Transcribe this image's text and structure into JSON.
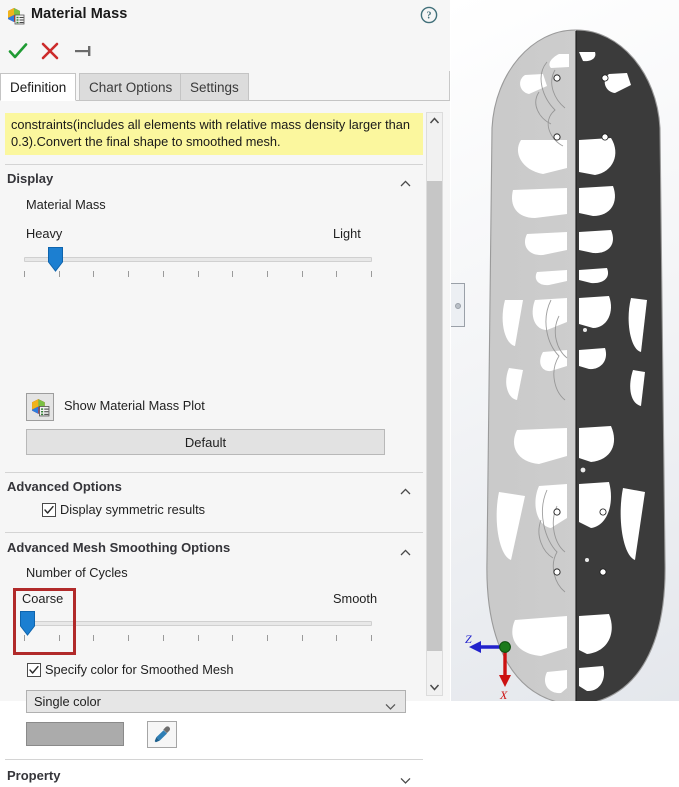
{
  "window": {
    "title": "Material Mass",
    "icon": "material-mass-icon",
    "help_icon": "help-icon"
  },
  "actions": [
    {
      "name": "accept-button",
      "icon": "checkmark-icon",
      "color": "#1f9b33"
    },
    {
      "name": "cancel-button",
      "icon": "x-mark-icon",
      "color": "#cc2b2b"
    },
    {
      "name": "pin-button",
      "icon": "pushpin-icon",
      "color": "#6b6b6b"
    }
  ],
  "tabs": [
    {
      "label": "Definition",
      "active": true
    },
    {
      "label": "Chart Options",
      "active": false
    },
    {
      "label": "Settings",
      "active": false
    }
  ],
  "message": "constraints(includes all elements with relative mass density larger than 0.3).Convert the final shape to smoothed mesh.",
  "sections": {
    "display": {
      "header": "Display",
      "collapsed": false,
      "subtitle": "Material Mass",
      "slider": {
        "left_label": "Heavy",
        "right_label": "Light",
        "value_percent": 9,
        "tick_count": 11
      },
      "plot_button_label": "Show Material Mass Plot",
      "plot_button_icon": "material-mass-plot-icon",
      "default_button_label": "Default"
    },
    "advanced_options": {
      "header": "Advanced Options",
      "collapsed": false,
      "checkbox_label": "Display symmetric results",
      "checkbox_checked": true
    },
    "mesh_smoothing": {
      "header": "Advanced Mesh Smoothing Options",
      "collapsed": false,
      "subtitle": "Number of Cycles",
      "slider": {
        "left_label": "Coarse",
        "right_label": "Smooth",
        "value_percent": 1,
        "tick_count": 11
      },
      "checkbox_label": "Specify color for Smoothed Mesh",
      "checkbox_checked": true,
      "color_mode": "Single color",
      "color_value": "#ababab",
      "eyedropper_icon": "eyedropper-icon"
    },
    "property": {
      "header": "Property",
      "collapsed": true
    }
  },
  "annotation": {
    "name": "red-highlight-box",
    "color": "#b12a2a"
  },
  "viewport": {
    "model_name": "topology-optimized-part",
    "left_half_color": "#c9c9c9",
    "right_half_color": "#3b3b3b",
    "void_color": "#ffffff",
    "triad": {
      "z_axis_label": "Z",
      "z_axis_color": "#2222cc",
      "x_axis_label": "X",
      "x_axis_color": "#cc1111",
      "origin_color": "#1a7a1a"
    }
  },
  "scrollbar": {
    "up_icon": "chevron-up-icon",
    "down_icon": "chevron-down-icon"
  }
}
